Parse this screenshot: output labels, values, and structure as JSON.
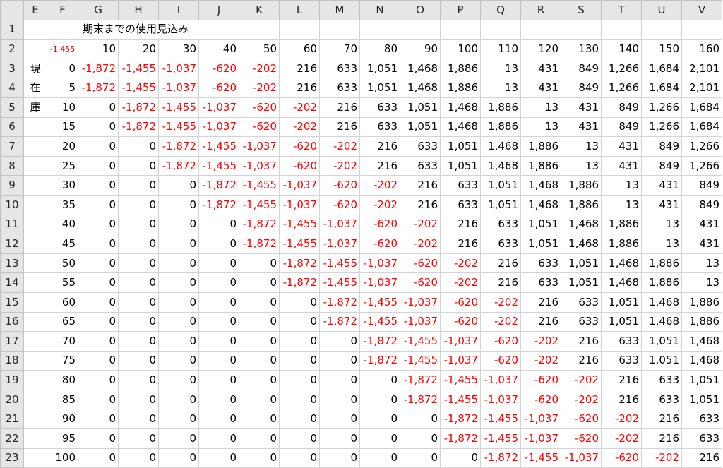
{
  "column_headers": [
    "E",
    "F",
    "G",
    "H",
    "I",
    "J",
    "K",
    "L",
    "M",
    "N",
    "O",
    "P",
    "Q",
    "R",
    "S",
    "T",
    "U",
    "V"
  ],
  "row_numbers": [
    "1",
    "2",
    "3",
    "4",
    "5",
    "6",
    "7",
    "8",
    "9",
    "10",
    "11",
    "12",
    "13",
    "14",
    "15",
    "16",
    "17",
    "18",
    "19",
    "20",
    "21",
    "22",
    "23"
  ],
  "title_cell": "期末までの使用見込み",
  "f2_value": "-1,455",
  "usage_headers": [
    "10",
    "20",
    "30",
    "40",
    "50",
    "60",
    "70",
    "80",
    "90",
    "100",
    "110",
    "120",
    "130",
    "140",
    "150",
    "160"
  ],
  "side_label": [
    "現",
    "在",
    "庫"
  ],
  "stock_values": [
    "0",
    "5",
    "10",
    "15",
    "20",
    "25",
    "30",
    "35",
    "40",
    "45",
    "50",
    "55",
    "60",
    "65",
    "70",
    "75",
    "80",
    "85",
    "90",
    "95",
    "100"
  ],
  "grid": [
    [
      "-1,872",
      "-1,455",
      "-1,037",
      "-620",
      "-202",
      "216",
      "633",
      "1,051",
      "1,468",
      "1,886",
      "13",
      "431",
      "849",
      "1,266",
      "1,684",
      "2,101"
    ],
    [
      "-1,872",
      "-1,455",
      "-1,037",
      "-620",
      "-202",
      "216",
      "633",
      "1,051",
      "1,468",
      "1,886",
      "13",
      "431",
      "849",
      "1,266",
      "1,684",
      "2,101"
    ],
    [
      "0",
      "-1,872",
      "-1,455",
      "-1,037",
      "-620",
      "-202",
      "216",
      "633",
      "1,051",
      "1,468",
      "1,886",
      "13",
      "431",
      "849",
      "1,266",
      "1,684"
    ],
    [
      "0",
      "-1,872",
      "-1,455",
      "-1,037",
      "-620",
      "-202",
      "216",
      "633",
      "1,051",
      "1,468",
      "1,886",
      "13",
      "431",
      "849",
      "1,266",
      "1,684"
    ],
    [
      "0",
      "0",
      "-1,872",
      "-1,455",
      "-1,037",
      "-620",
      "-202",
      "216",
      "633",
      "1,051",
      "1,468",
      "1,886",
      "13",
      "431",
      "849",
      "1,266"
    ],
    [
      "0",
      "0",
      "-1,872",
      "-1,455",
      "-1,037",
      "-620",
      "-202",
      "216",
      "633",
      "1,051",
      "1,468",
      "1,886",
      "13",
      "431",
      "849",
      "1,266"
    ],
    [
      "0",
      "0",
      "0",
      "-1,872",
      "-1,455",
      "-1,037",
      "-620",
      "-202",
      "216",
      "633",
      "1,051",
      "1,468",
      "1,886",
      "13",
      "431",
      "849"
    ],
    [
      "0",
      "0",
      "0",
      "-1,872",
      "-1,455",
      "-1,037",
      "-620",
      "-202",
      "216",
      "633",
      "1,051",
      "1,468",
      "1,886",
      "13",
      "431",
      "849"
    ],
    [
      "0",
      "0",
      "0",
      "0",
      "-1,872",
      "-1,455",
      "-1,037",
      "-620",
      "-202",
      "216",
      "633",
      "1,051",
      "1,468",
      "1,886",
      "13",
      "431"
    ],
    [
      "0",
      "0",
      "0",
      "0",
      "-1,872",
      "-1,455",
      "-1,037",
      "-620",
      "-202",
      "216",
      "633",
      "1,051",
      "1,468",
      "1,886",
      "13",
      "431"
    ],
    [
      "0",
      "0",
      "0",
      "0",
      "0",
      "-1,872",
      "-1,455",
      "-1,037",
      "-620",
      "-202",
      "216",
      "633",
      "1,051",
      "1,468",
      "1,886",
      "13"
    ],
    [
      "0",
      "0",
      "0",
      "0",
      "0",
      "-1,872",
      "-1,455",
      "-1,037",
      "-620",
      "-202",
      "216",
      "633",
      "1,051",
      "1,468",
      "1,886",
      "13"
    ],
    [
      "0",
      "0",
      "0",
      "0",
      "0",
      "0",
      "-1,872",
      "-1,455",
      "-1,037",
      "-620",
      "-202",
      "216",
      "633",
      "1,051",
      "1,468",
      "1,886"
    ],
    [
      "0",
      "0",
      "0",
      "0",
      "0",
      "0",
      "-1,872",
      "-1,455",
      "-1,037",
      "-620",
      "-202",
      "216",
      "633",
      "1,051",
      "1,468",
      "1,886"
    ],
    [
      "0",
      "0",
      "0",
      "0",
      "0",
      "0",
      "0",
      "-1,872",
      "-1,455",
      "-1,037",
      "-620",
      "-202",
      "216",
      "633",
      "1,051",
      "1,468"
    ],
    [
      "0",
      "0",
      "0",
      "0",
      "0",
      "0",
      "0",
      "-1,872",
      "-1,455",
      "-1,037",
      "-620",
      "-202",
      "216",
      "633",
      "1,051",
      "1,468"
    ],
    [
      "0",
      "0",
      "0",
      "0",
      "0",
      "0",
      "0",
      "0",
      "-1,872",
      "-1,455",
      "-1,037",
      "-620",
      "-202",
      "216",
      "633",
      "1,051"
    ],
    [
      "0",
      "0",
      "0",
      "0",
      "0",
      "0",
      "0",
      "0",
      "-1,872",
      "-1,455",
      "-1,037",
      "-620",
      "-202",
      "216",
      "633",
      "1,051"
    ],
    [
      "0",
      "0",
      "0",
      "0",
      "0",
      "0",
      "0",
      "0",
      "0",
      "-1,872",
      "-1,455",
      "-1,037",
      "-620",
      "-202",
      "216",
      "633"
    ],
    [
      "0",
      "0",
      "0",
      "0",
      "0",
      "0",
      "0",
      "0",
      "0",
      "-1,872",
      "-1,455",
      "-1,037",
      "-620",
      "-202",
      "216",
      "633"
    ],
    [
      "0",
      "0",
      "0",
      "0",
      "0",
      "0",
      "0",
      "0",
      "0",
      "0",
      "-1,872",
      "-1,455",
      "-1,037",
      "-620",
      "-202",
      "216"
    ]
  ],
  "colors": {
    "negative": "#ff0000",
    "header_bg": "#e6e6e6",
    "gridline": "#d4d4d4"
  }
}
